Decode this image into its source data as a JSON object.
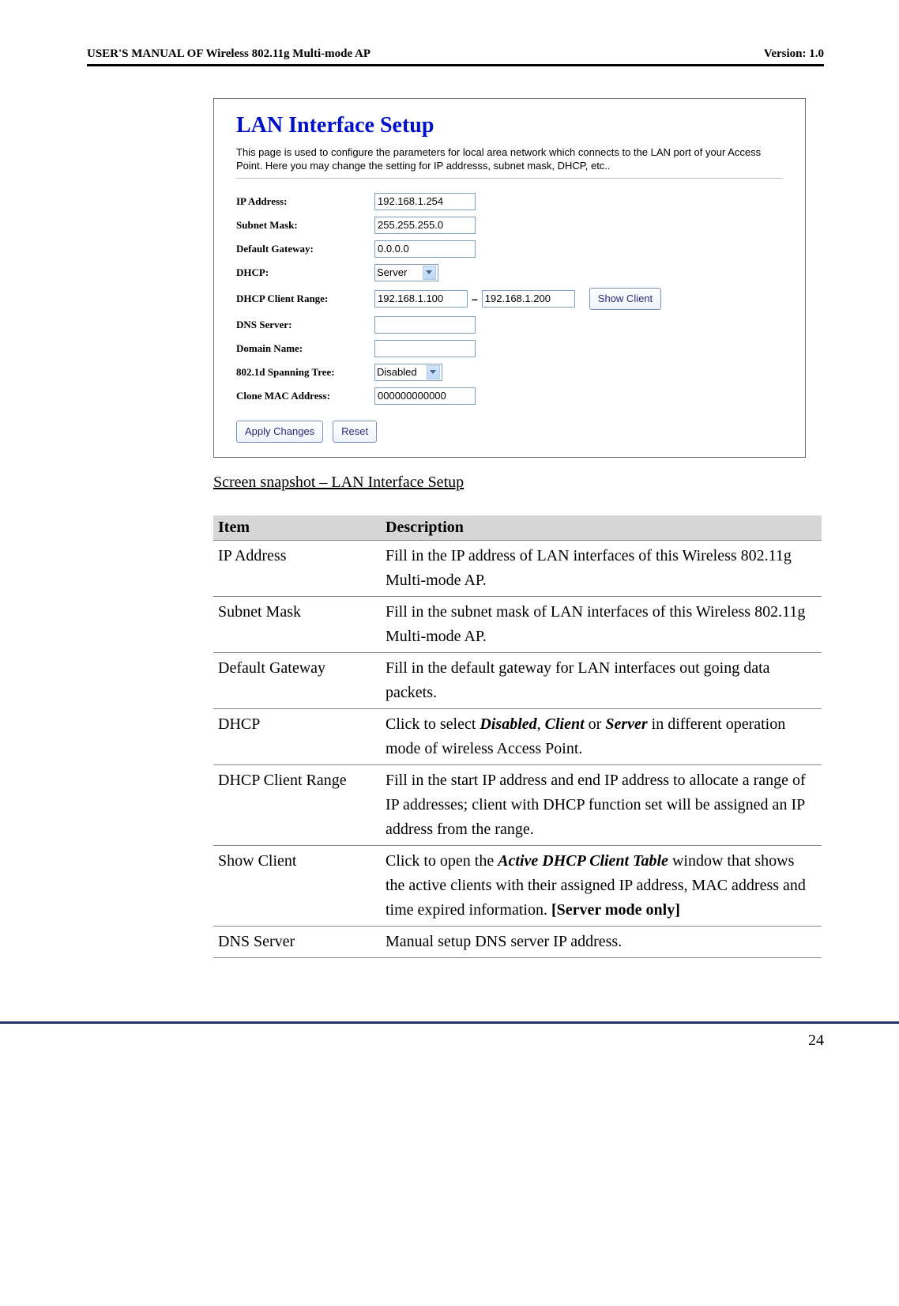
{
  "header": {
    "left": "USER'S MANUAL OF Wireless 802.11g Multi-mode AP",
    "right": "Version: 1.0"
  },
  "screenshot": {
    "title": "LAN Interface Setup",
    "description": "This page is used to configure the parameters for local area network which connects to the LAN port of your Access Point. Here you may change the setting for IP addresss, subnet mask, DHCP, etc..",
    "rows": {
      "ip_label": "IP Address:",
      "ip_value": "192.168.1.254",
      "subnet_label": "Subnet Mask:",
      "subnet_value": "255.255.255.0",
      "gateway_label": "Default Gateway:",
      "gateway_value": "0.0.0.0",
      "dhcp_label": "DHCP:",
      "dhcp_value": "Server",
      "range_label": "DHCP Client Range:",
      "range_start": "192.168.1.100",
      "range_end": "192.168.1.200",
      "show_client": "Show Client",
      "dns_label": "DNS Server:",
      "dns_value": "",
      "domain_label": "Domain Name:",
      "domain_value": "",
      "spanning_label": "802.1d Spanning Tree:",
      "spanning_value": "Disabled",
      "mac_label": "Clone MAC Address:",
      "mac_value": "000000000000"
    },
    "buttons": {
      "apply": "Apply Changes",
      "reset": "Reset"
    }
  },
  "caption": "Screen snapshot – LAN Interface Setup",
  "table": {
    "headers": {
      "item": "Item",
      "desc": "Description"
    },
    "rows": [
      {
        "item": "IP Address",
        "desc": "Fill in the IP address of LAN interfaces of this Wireless 802.11g Multi-mode AP."
      },
      {
        "item": "Subnet Mask",
        "desc": "Fill in the subnet mask of LAN interfaces of this Wireless 802.11g Multi-mode AP."
      },
      {
        "item": "Default Gateway",
        "desc": "Fill in the default gateway for LAN interfaces out going data packets."
      },
      {
        "item": "DHCP",
        "desc_pre": "Click to select ",
        "d1": "Disabled",
        "sep1": ", ",
        "d2": "Client",
        "sep2": " or ",
        "d3": "Server",
        "desc_post": " in different operation mode of wireless Access Point."
      },
      {
        "item": "DHCP Client Range",
        "desc": "Fill in the start IP address and end IP address to allocate a range of IP addresses; client with DHCP function set will be assigned an IP address from the range."
      },
      {
        "item": "Show Client",
        "desc_pre": "Click to open the ",
        "d1": "Active DHCP Client Table",
        "desc_mid": " window that shows the active clients with their assigned IP address, MAC address and time expired information. ",
        "bold_suffix": "[Server mode only]"
      },
      {
        "item": "DNS Server",
        "desc": "Manual setup DNS server IP address."
      }
    ]
  },
  "page_number": "24"
}
